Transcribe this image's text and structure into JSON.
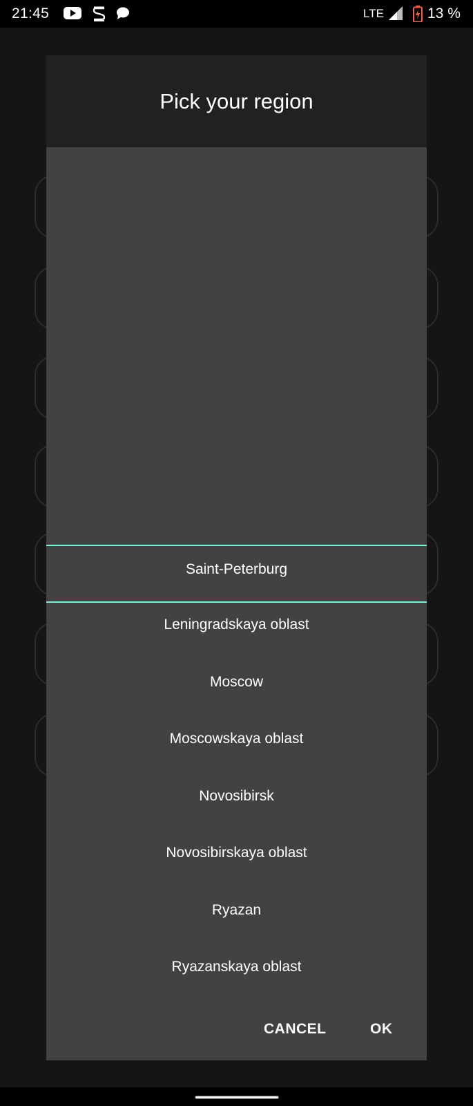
{
  "status_bar": {
    "time": "21:45",
    "network": "LTE",
    "battery": "13 %",
    "icons": [
      "youtube-icon",
      "s-app-icon",
      "message-icon",
      "signal-icon",
      "battery-charging-icon"
    ],
    "battery_color": "#ff5a3c"
  },
  "dialog": {
    "title": "Pick your region",
    "picker": {
      "selected": "Saint-Peterburg",
      "options": [
        "Leningradskaya oblast",
        "Moscow",
        "Moscowskaya oblast",
        "Novosibirsk",
        "Novosibirskaya oblast",
        "Ryazan",
        "Ryazanskaya oblast"
      ],
      "divider_color": "#64ffda"
    },
    "buttons": {
      "cancel": "CANCEL",
      "ok": "OK"
    }
  }
}
